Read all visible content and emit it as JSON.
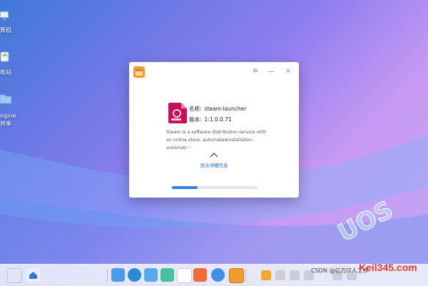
{
  "desktop": {
    "icons": [
      {
        "label": "算机",
        "icon": "computer-icon"
      },
      {
        "label": "收站",
        "icon": "trash-icon"
      },
      {
        "label": "ngine",
        "icon": "folder-icon"
      },
      {
        "label": "共享",
        "icon": "share-icon"
      }
    ]
  },
  "dialog": {
    "menu_icon": "≡",
    "close_icon": "✕",
    "package": {
      "name_key": "名称:",
      "name_value": "steam-launcher",
      "version_key": "版本:",
      "version_value": "1:1.0.0.71"
    },
    "description": "Steam is a software distribution service with an online store, automatedinstallation, automati···",
    "toggle_label": "显示详细信息",
    "progress": 0.3
  },
  "taskbar": {
    "items": [
      "multitask-view-icon",
      "launcher-icon",
      "file-manager-icon",
      "browser-icon",
      "image-viewer-icon",
      "music-icon",
      "calendar-icon",
      "app-store-icon",
      "settings-icon",
      "package-installer-icon",
      "shield-icon",
      "volume-icon",
      "battery-icon",
      "network-icon",
      "usb-icon",
      "power-icon"
    ]
  },
  "watermark": {
    "text": "CSDN @亿万IT人工作",
    "brand": "Keil345.com"
  },
  "logo_text": "UOS",
  "colors": {
    "accent": "#2f7fe6",
    "link": "#1b64d8",
    "package_icon": "#c4125a",
    "app_icon_orange": "#f29a2e"
  }
}
